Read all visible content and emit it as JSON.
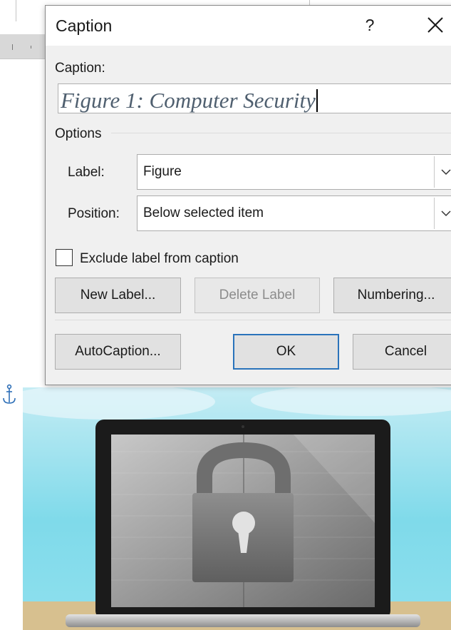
{
  "dialog": {
    "title": "Caption",
    "help_label": "?",
    "caption_label": "Caption:",
    "caption_value": "Figure 1: Computer Security",
    "options_label": "Options",
    "label_field": {
      "label": "Label:",
      "value": "Figure"
    },
    "position_field": {
      "label": "Position:",
      "value": "Below selected item"
    },
    "exclude_label": "Exclude label from caption",
    "exclude_checked": false,
    "buttons": {
      "new_label": "New Label...",
      "delete_label": "Delete Label",
      "numbering": "Numbering...",
      "autocaption": "AutoCaption...",
      "ok": "OK",
      "cancel": "Cancel"
    }
  },
  "colors": {
    "dialog_bg": "#f0f0f0",
    "default_button_border": "#2a73bb",
    "caption_text": "#4f5f6f"
  },
  "document": {
    "image_subject": "laptop-with-padlock-image",
    "anchor_icon": "anchor-icon"
  }
}
